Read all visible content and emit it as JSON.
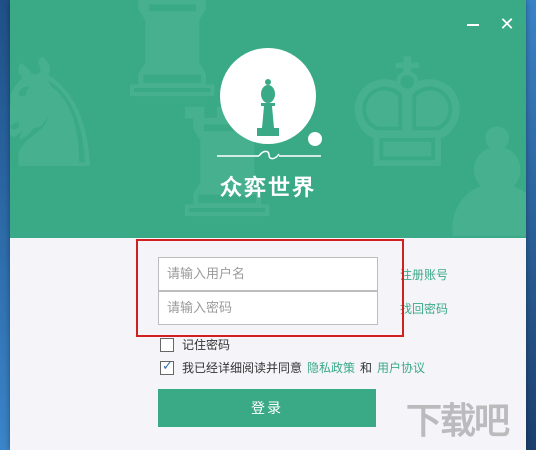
{
  "app": {
    "name": "众弈世界"
  },
  "window_controls": {
    "minimize_icon": "minimize-icon",
    "close_symbol": "✕"
  },
  "login": {
    "username_placeholder": "请输入用户名",
    "password_placeholder": "请输入密码",
    "register_link": "注册账号",
    "forgot_link": "找回密码",
    "remember_label": "记住密码",
    "remember_checked": false,
    "agree_prefix": "我已经详细阅读并同意",
    "privacy_link": "隐私政策",
    "and_text": "和",
    "terms_link": "用户协议",
    "agree_checked": true,
    "login_button": "登录"
  },
  "colors": {
    "brand": "#3aaa86",
    "highlight": "#d21f1f"
  },
  "watermark": {
    "text": "下载吧"
  }
}
